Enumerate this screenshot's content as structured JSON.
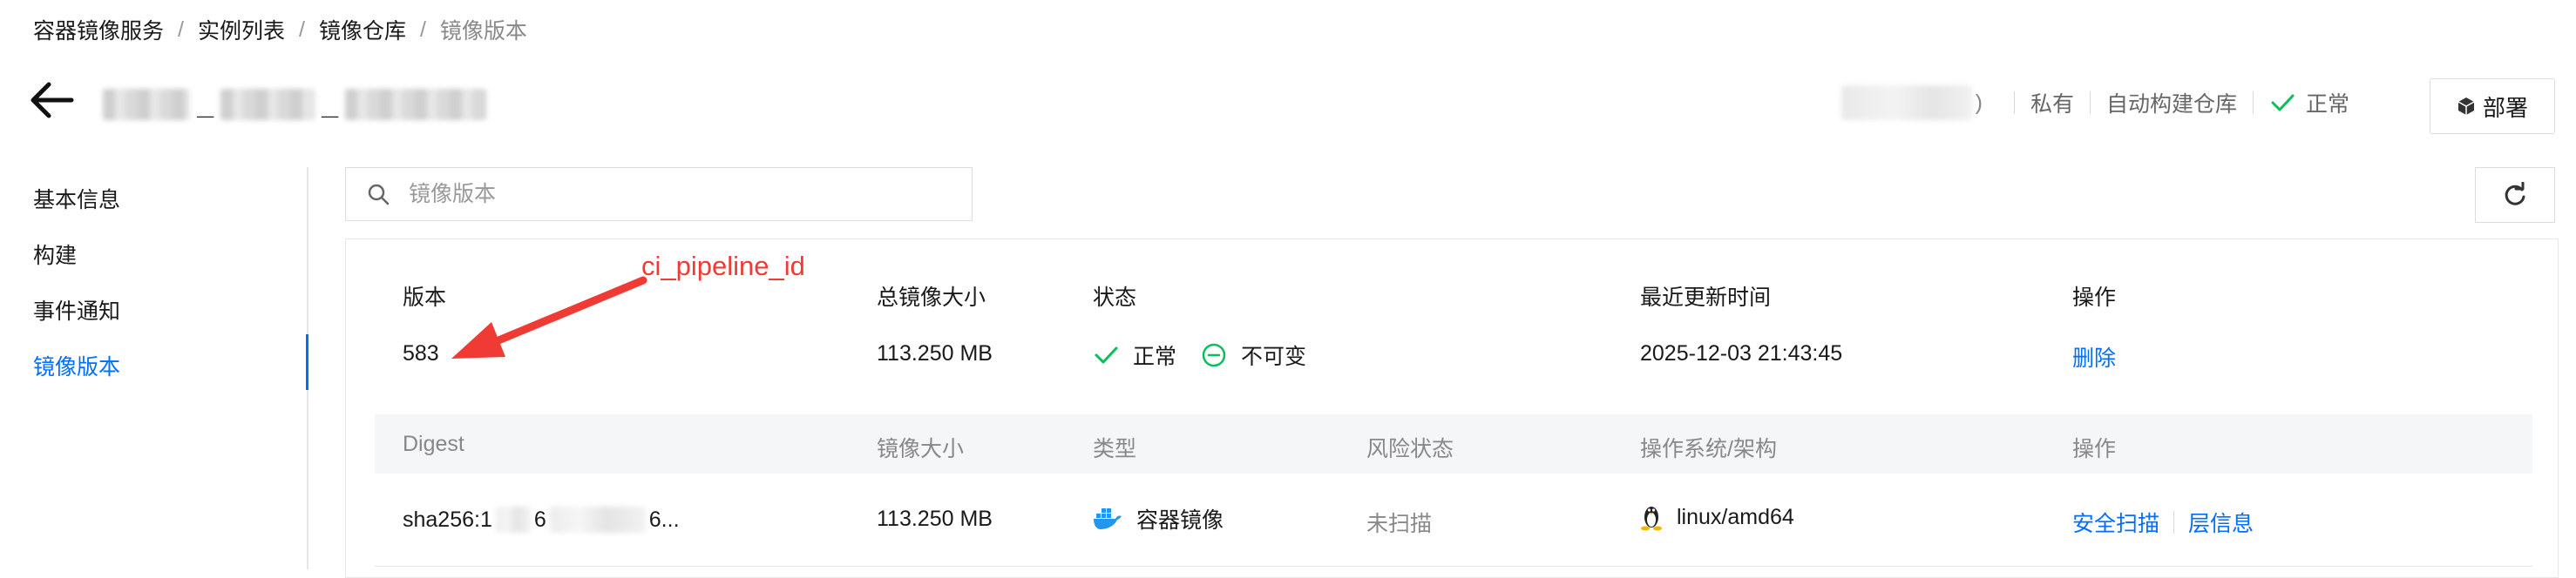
{
  "breadcrumb": [
    "容器镜像服务",
    "实例列表",
    "镜像仓库",
    "镜像版本"
  ],
  "header": {
    "repo_name_sep1": "_",
    "repo_name_sep2": "_",
    "paren_close": ")",
    "visibility": "私有",
    "auto_build": "自动构建仓库",
    "status": "正常",
    "deploy_label": "部署"
  },
  "sidebar": {
    "items": [
      {
        "label": "基本信息"
      },
      {
        "label": "构建"
      },
      {
        "label": "事件通知"
      },
      {
        "label": "镜像版本",
        "active": true
      }
    ]
  },
  "search": {
    "placeholder": "镜像版本"
  },
  "version_table": {
    "headers": [
      "版本",
      "总镜像大小",
      "状态",
      "最近更新时间",
      "操作"
    ],
    "row": {
      "version": "583",
      "total_size": "113.250 MB",
      "status1": "正常",
      "status2": "不可变",
      "updated": "2025-12-03 21:43:45",
      "action": "删除"
    }
  },
  "digest_table": {
    "headers": [
      "Digest",
      "镜像大小",
      "类型",
      "风险状态",
      "操作系统/架构",
      "操作"
    ],
    "row": {
      "digest_prefix": "sha256:1",
      "digest_mid": "6",
      "digest_suffix": "6...",
      "size": "113.250 MB",
      "type": "容器镜像",
      "risk": "未扫描",
      "os_arch": "linux/amd64",
      "action1": "安全扫描",
      "action2": "层信息"
    }
  },
  "annotation": {
    "text": "ci_pipeline_id"
  },
  "colors": {
    "accent": "#006eff",
    "success": "#0abf5b",
    "annotation": "#ef3b34"
  },
  "icons": [
    "arrow-left-icon",
    "check-icon",
    "deploy-cube-icon",
    "search-icon",
    "refresh-icon",
    "minus-circle-icon",
    "docker-icon",
    "linux-icon"
  ]
}
